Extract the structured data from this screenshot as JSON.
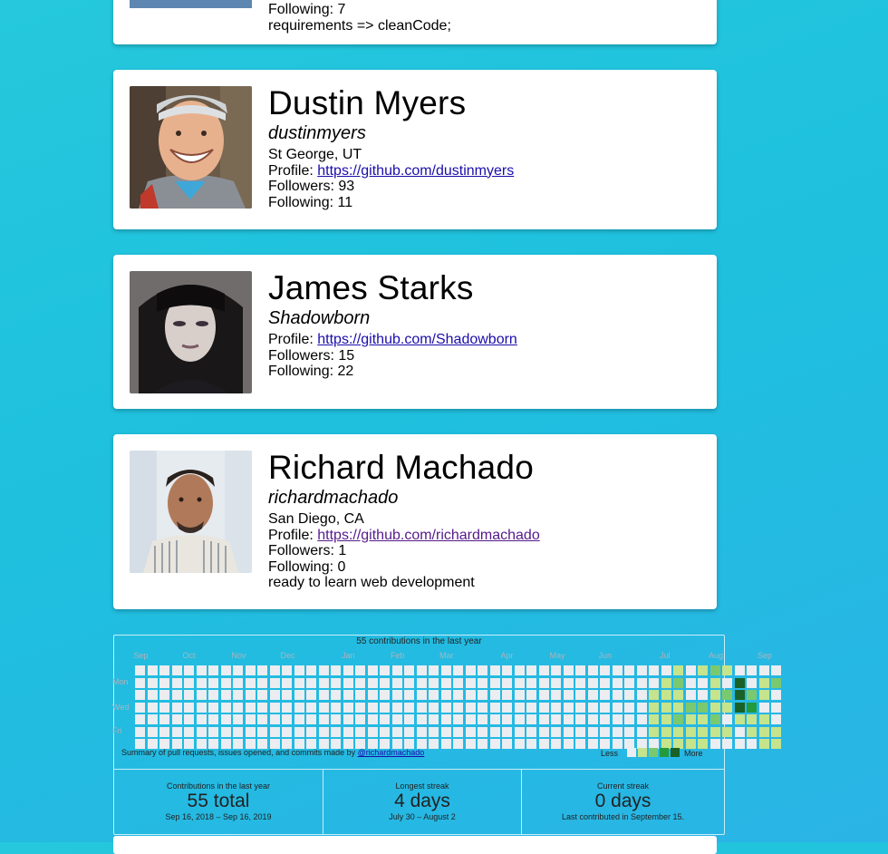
{
  "top_card": {
    "following": "Following: 7",
    "bio": "requirements => cleanCode;"
  },
  "users": [
    {
      "name": "Dustin Myers",
      "login": "dustinmyers",
      "location": "St George, UT",
      "profile_label": "Profile: ",
      "profile_url": "https://github.com/dustinmyers",
      "followers": "Followers: 93",
      "following": "Following: 11"
    },
    {
      "name": "James Starks",
      "login": "Shadowborn",
      "profile_label": "Profile: ",
      "profile_url": "https://github.com/Shadowborn",
      "followers": "Followers: 15",
      "following": "Following: 22"
    },
    {
      "name": "Richard Machado",
      "login": "richardmachado",
      "location": "San Diego, CA",
      "profile_label": "Profile: ",
      "profile_url": "https://github.com/richardmachado",
      "followers": "Followers: 1",
      "following": "Following: 0",
      "bio": "ready to learn web development"
    }
  ],
  "calendar": {
    "title": "55 contributions in the last year",
    "months": [
      "Sep",
      "Oct",
      "Nov",
      "Dec",
      "Jan",
      "Feb",
      "Mar",
      "Apr",
      "May",
      "Jun",
      "Jul",
      "Aug",
      "Sep"
    ],
    "days": [
      "Mon",
      "Wed",
      "Fri"
    ],
    "summary_text": "Summary of pull requests, issues opened, and commits made by ",
    "summary_link": "@richardmachado",
    "legend_less": "Less",
    "legend_more": "More",
    "colors": [
      "#ebedf0",
      "#c6e48b",
      "#7bc96f",
      "#239a3b",
      "#196127"
    ],
    "weeks": 53,
    "active": [
      [
        42,
        2,
        1
      ],
      [
        42,
        3,
        1
      ],
      [
        42,
        4,
        1
      ],
      [
        42,
        5,
        1
      ],
      [
        43,
        1,
        1
      ],
      [
        43,
        2,
        1
      ],
      [
        43,
        3,
        1
      ],
      [
        43,
        4,
        1
      ],
      [
        43,
        5,
        1
      ],
      [
        43,
        6,
        1
      ],
      [
        44,
        0,
        1
      ],
      [
        44,
        1,
        2
      ],
      [
        44,
        2,
        1
      ],
      [
        44,
        3,
        1
      ],
      [
        44,
        4,
        2
      ],
      [
        44,
        5,
        1
      ],
      [
        44,
        6,
        1
      ],
      [
        45,
        3,
        2
      ],
      [
        45,
        4,
        1
      ],
      [
        45,
        5,
        1
      ],
      [
        45,
        6,
        1
      ],
      [
        46,
        0,
        1
      ],
      [
        46,
        3,
        2
      ],
      [
        46,
        4,
        1
      ],
      [
        46,
        5,
        1
      ],
      [
        46,
        6,
        1
      ],
      [
        47,
        0,
        2
      ],
      [
        47,
        1,
        1
      ],
      [
        47,
        2,
        1
      ],
      [
        47,
        3,
        1
      ],
      [
        47,
        4,
        2
      ],
      [
        47,
        5,
        1
      ],
      [
        48,
        0,
        1
      ],
      [
        48,
        2,
        2
      ],
      [
        48,
        3,
        1
      ],
      [
        48,
        5,
        1
      ],
      [
        49,
        1,
        4
      ],
      [
        49,
        2,
        4
      ],
      [
        49,
        3,
        4
      ],
      [
        49,
        4,
        1
      ],
      [
        50,
        2,
        2
      ],
      [
        50,
        3,
        3
      ],
      [
        50,
        4,
        1
      ],
      [
        50,
        5,
        1
      ],
      [
        51,
        1,
        1
      ],
      [
        51,
        2,
        1
      ],
      [
        51,
        4,
        1
      ],
      [
        51,
        5,
        1
      ],
      [
        51,
        6,
        1
      ],
      [
        52,
        1,
        2
      ],
      [
        52,
        5,
        1
      ],
      [
        52,
        6,
        1
      ]
    ]
  },
  "stats": [
    {
      "label": "Contributions in the last year",
      "value": "55 total",
      "range": "Sep 16, 2018 – Sep 16, 2019"
    },
    {
      "label": "Longest streak",
      "value": "4 days",
      "range": "July 30 – August 2"
    },
    {
      "label": "Current streak",
      "value": "0 days",
      "range": "Last contributed in September 15."
    }
  ]
}
